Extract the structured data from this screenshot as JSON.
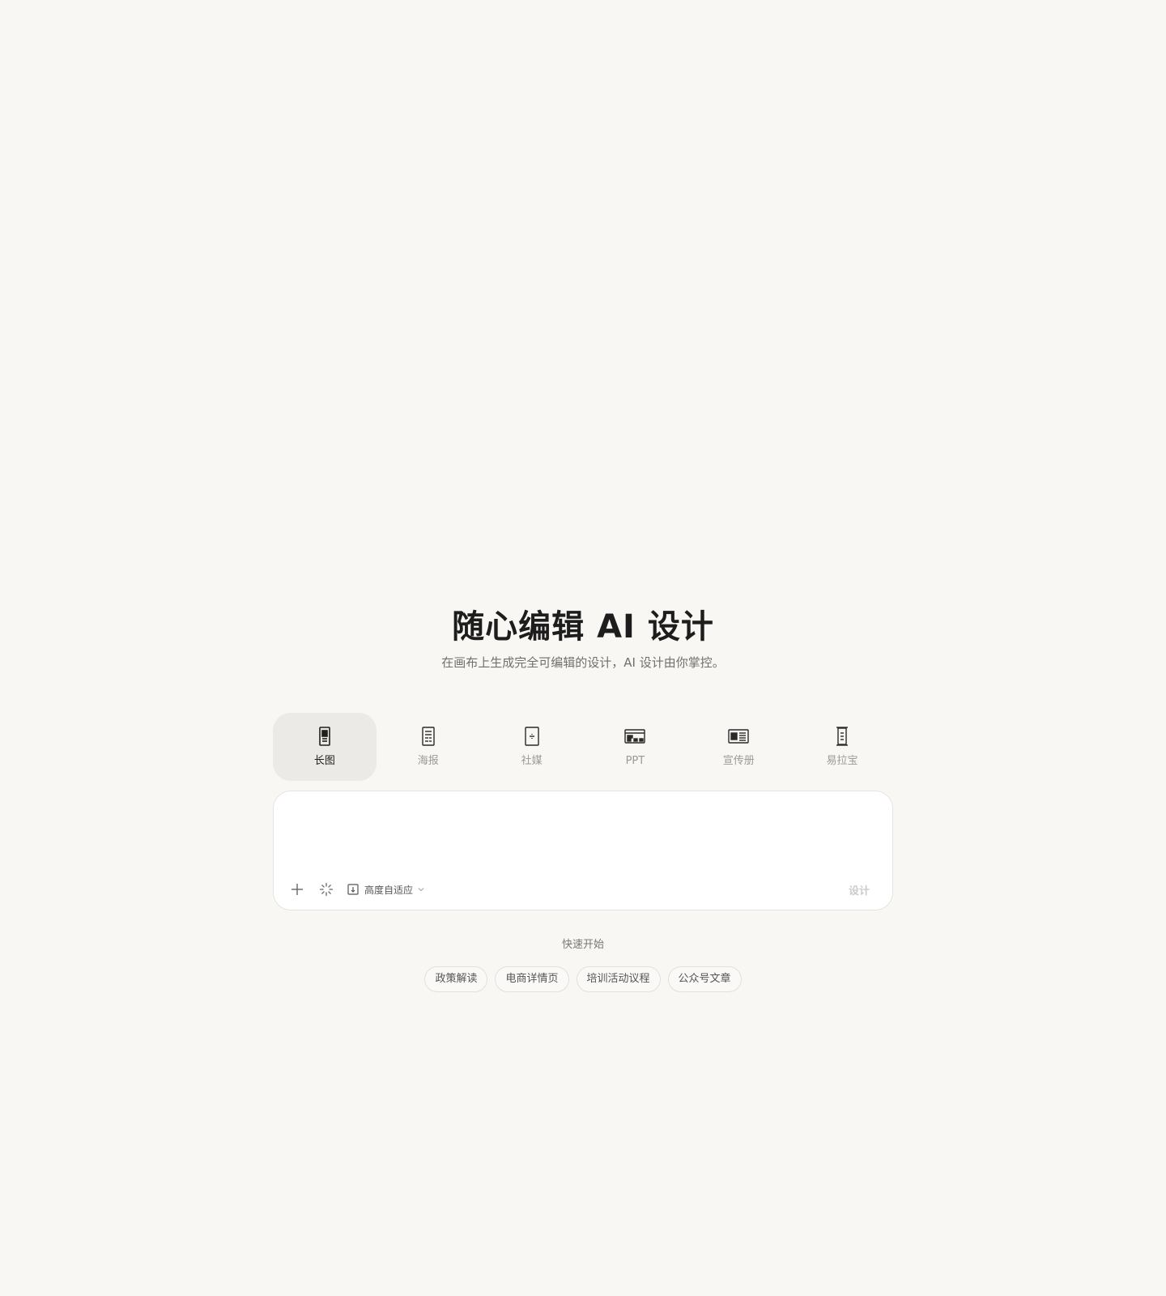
{
  "hero": {
    "title": "随心编辑 AI 设计",
    "subtitle": "在画布上生成完全可编辑的设计，AI 设计由你掌控。"
  },
  "tabs": [
    {
      "label": "长图",
      "icon": "long-image-icon",
      "active": true
    },
    {
      "label": "海报",
      "icon": "poster-icon",
      "active": false
    },
    {
      "label": "社媒",
      "icon": "social-media-icon",
      "active": false
    },
    {
      "label": "PPT",
      "icon": "ppt-icon",
      "active": false
    },
    {
      "label": "宣传册",
      "icon": "brochure-icon",
      "active": false
    },
    {
      "label": "易拉宝",
      "icon": "rollup-banner-icon",
      "active": false
    }
  ],
  "composer": {
    "input_value": "",
    "height_option": "高度自适应",
    "submit_label": "设计"
  },
  "quick_start": {
    "title": "快速开始",
    "chips": [
      "政策解读",
      "电商详情页",
      "培训活动议程",
      "公众号文章"
    ]
  },
  "colors": {
    "background": "#f8f7f4",
    "active_tab": "#ebeae7",
    "panel": "#ffffff",
    "border": "#e4e3df"
  }
}
